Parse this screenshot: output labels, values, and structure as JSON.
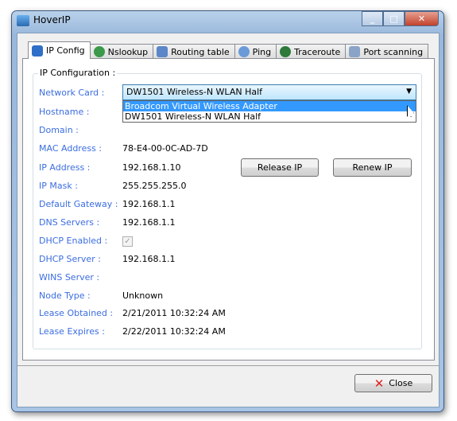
{
  "window": {
    "title": "HoverIP",
    "minimize": "_",
    "maximize": "□",
    "close": "✕"
  },
  "tabs": [
    {
      "label": "IP Config",
      "icon": "info-icon",
      "color": "#2f6fc8"
    },
    {
      "label": "Nslookup",
      "icon": "globe-icon",
      "color": "#3a9a4a"
    },
    {
      "label": "Routing table",
      "icon": "network-icon",
      "color": "#5b86c8"
    },
    {
      "label": "Ping",
      "icon": "magnifier-icon",
      "color": "#6a9ad8"
    },
    {
      "label": "Traceroute",
      "icon": "globe-icon",
      "color": "#2d7a3a"
    },
    {
      "label": "Port scanning",
      "icon": "scan-icon",
      "color": "#8aa4c8"
    }
  ],
  "group": {
    "title": "IP Configuration :"
  },
  "fields": {
    "network_card": {
      "label": "Network Card :",
      "value": "DW1501 Wireless-N WLAN Half",
      "options": [
        "Broadcom Virtual Wireless Adapter",
        "DW1501 Wireless-N WLAN Half"
      ],
      "highlighted": "Broadcom Virtual Wireless Adapter"
    },
    "hostname": {
      "label": "Hostname :"
    },
    "domain": {
      "label": "Domain :"
    },
    "mac": {
      "label": "MAC Address :",
      "value": "78-E4-00-0C-AD-7D"
    },
    "ip": {
      "label": "IP Address :",
      "value": "192.168.1.10"
    },
    "mask": {
      "label": "IP Mask :",
      "value": "255.255.255.0"
    },
    "gateway": {
      "label": "Default Gateway :",
      "value": "192.168.1.1"
    },
    "dns": {
      "label": "DNS Servers :",
      "value": "192.168.1.1"
    },
    "dhcp_enabled": {
      "label": "DHCP Enabled :",
      "checked": true
    },
    "dhcp_server": {
      "label": "DHCP Server :",
      "value": "192.168.1.1"
    },
    "wins": {
      "label": "WINS Server :"
    },
    "node_type": {
      "label": "Node Type :",
      "value": "Unknown"
    },
    "lease_obtained": {
      "label": "Lease Obtained :",
      "value": "2/21/2011 10:32:24 AM"
    },
    "lease_expires": {
      "label": "Lease Expires :",
      "value": "2/22/2011 10:32:24 AM"
    }
  },
  "buttons": {
    "release": "Release IP",
    "renew": "Renew IP",
    "close": "Close",
    "close_icon": "✕"
  }
}
